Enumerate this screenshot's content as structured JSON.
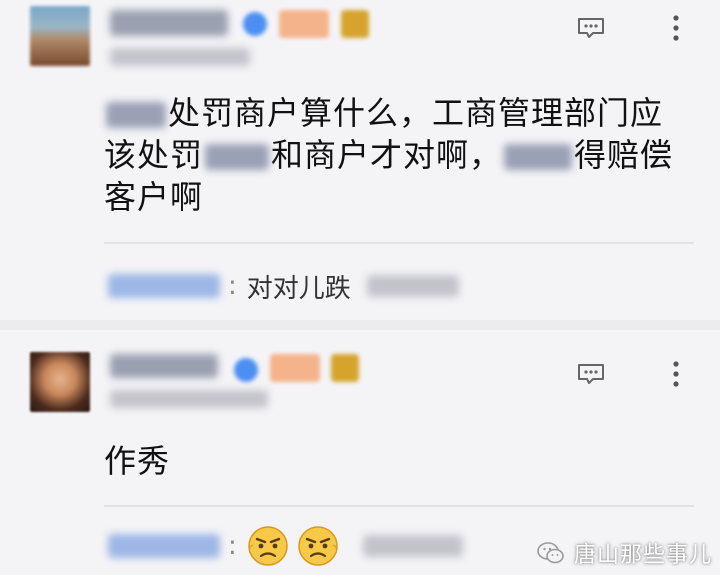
{
  "comments": [
    {
      "body": {
        "line1": "处罚商户算什么，工商管理部门应",
        "line2a": "该处罚",
        "line2b": "和商户才对啊，",
        "line2c": "得赔偿",
        "line3": "客户啊"
      },
      "reply": {
        "text": "对对儿跌"
      }
    },
    {
      "body": {
        "line1": "作秀"
      },
      "reply": {
        "emoji_count": 2
      }
    }
  ],
  "watermark": {
    "text": "唐山那些事儿"
  },
  "colors": {
    "background": "#f4f4f7",
    "verified_blue": "#4b8ff2",
    "level_orange": "#f4b38a"
  },
  "icons": [
    "comment-reply-icon",
    "more-vertical-icon",
    "angry-face-emoji",
    "wechat-logo"
  ]
}
